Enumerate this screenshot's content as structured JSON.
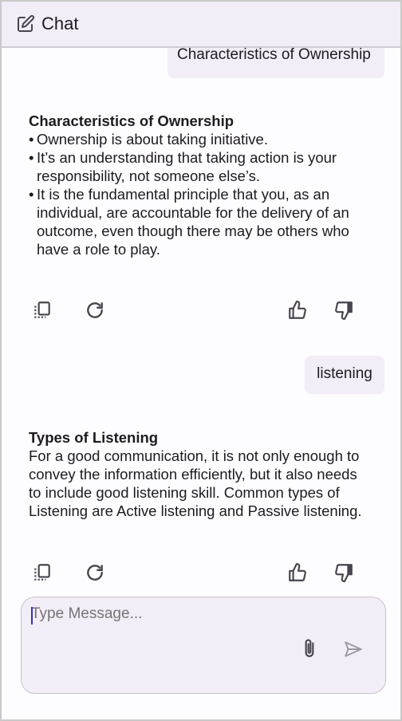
{
  "header": {
    "title": "Chat",
    "icon": "edit-icon"
  },
  "messages": {
    "partial_user_text": "Characteristics of Ownership",
    "bot1": {
      "title": "Characteristics of Ownership",
      "bullets": [
        "Ownership is about taking initiative.",
        "It’s an understanding that taking action is your responsibility, not someone else’s.",
        "It is the fundamental principle that you, as an individual, are accountable for the delivery of an outcome, even though there may be others who have a role to play."
      ]
    },
    "user2": "listening",
    "bot2": {
      "title": "Types of Listening",
      "body": "For a good communication, it is not only enough to convey the information efficiently, but it also needs to include good listening skill. Common types of Listening are Active listening and Passive listening."
    }
  },
  "actions": [
    "copy-icon",
    "refresh-icon",
    "thumbs-up-icon",
    "thumbs-down-icon"
  ],
  "composer": {
    "placeholder": "Type Message...",
    "attach_icon": "paperclip-icon",
    "send_icon": "send-icon"
  },
  "colors": {
    "header_bg": "#f3edf7",
    "bubble_bg": "#f3edf7",
    "icon": "#49454f",
    "caret": "#3b2bbf"
  }
}
